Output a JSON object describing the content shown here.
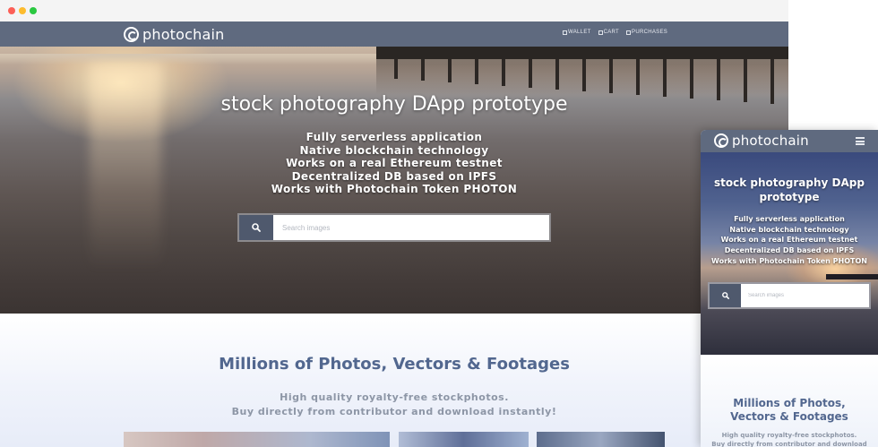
{
  "brand": {
    "name": "photochain"
  },
  "nav": {
    "links": [
      {
        "label": "WALLET"
      },
      {
        "label": "CART"
      },
      {
        "label": "PURCHASES"
      }
    ]
  },
  "hero": {
    "title": "stock photography DApp prototype",
    "features": [
      "Fully serverless application",
      "Native blockchain technology",
      "Works on a real Ethereum testnet",
      "Decentralized DB based on IPFS",
      "Works with Photochain Token PHOTON"
    ],
    "search": {
      "placeholder": "Search images"
    }
  },
  "content": {
    "title": "Millions of Photos, Vectors & Footages",
    "subtitle_lines": [
      "High quality royalty-free stockphotos.",
      "Buy directly from contributor and download instantly!"
    ]
  },
  "mobile": {
    "title": "stock photography DApp prototype",
    "content_title": "Millions of Photos, Vectors & Footages",
    "subtitle_lines": [
      "High quality royalty-free stockphotos.",
      "Buy directly from contributor and download"
    ]
  },
  "colors": {
    "nav_bg": "#5f6a7f",
    "search_button_bg": "#4f596d",
    "heading": "#52678f",
    "subtext": "#8d96a6"
  },
  "icons": [
    "photochain-logo-icon",
    "search-icon",
    "menu-icon",
    "wallet-icon",
    "cart-icon",
    "purchases-icon"
  ]
}
